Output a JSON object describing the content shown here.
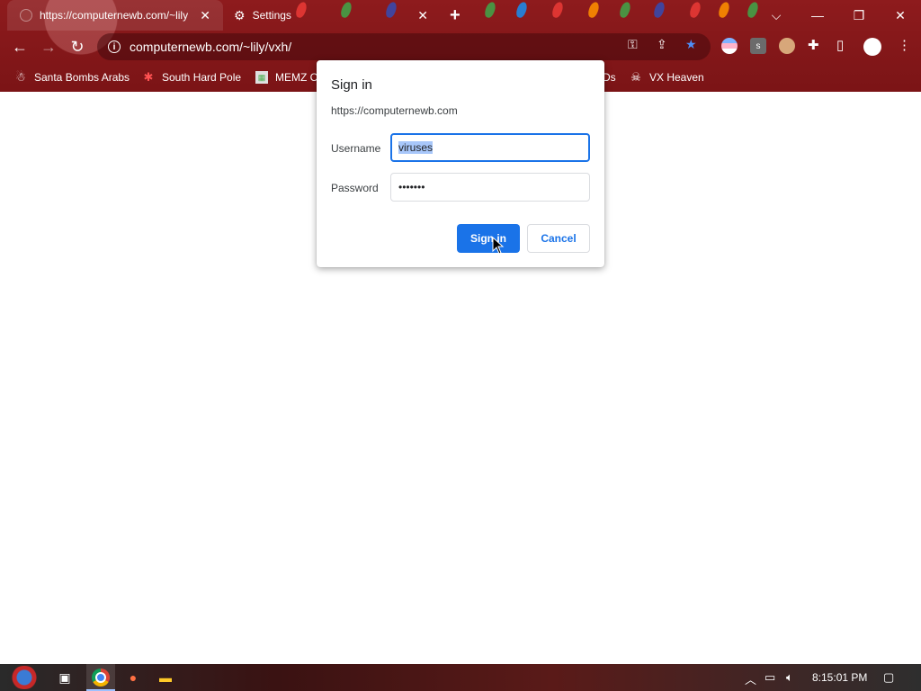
{
  "browser": {
    "tabs": [
      {
        "title": "https://computernewb.com/~lily",
        "close": "✕"
      },
      {
        "title": "Settings",
        "close": "✕"
      }
    ],
    "new_tab": "+",
    "window_controls": {
      "dropdown": "⌵",
      "minimize": "—",
      "restore": "❐",
      "close": "✕"
    },
    "url": "computernewb.com/~lily/vxh/",
    "bookmarks": [
      "Santa Bombs Arabs",
      "South Hard Pole",
      "MEMZ C",
      "Ds",
      "VX Heaven"
    ]
  },
  "dialog": {
    "title": "Sign in",
    "origin": "https://computernewb.com",
    "username_label": "Username",
    "username_value": "viruses",
    "password_label": "Password",
    "password_value": "•••••••",
    "sign_in_label": "Sign in",
    "cancel_label": "Cancel"
  },
  "taskbar": {
    "clock": "8:15:01 PM"
  },
  "colors": {
    "chrome_accent": "#8e1b1d",
    "primary_button": "#1a73e8",
    "selection": "#a8c7fa"
  }
}
